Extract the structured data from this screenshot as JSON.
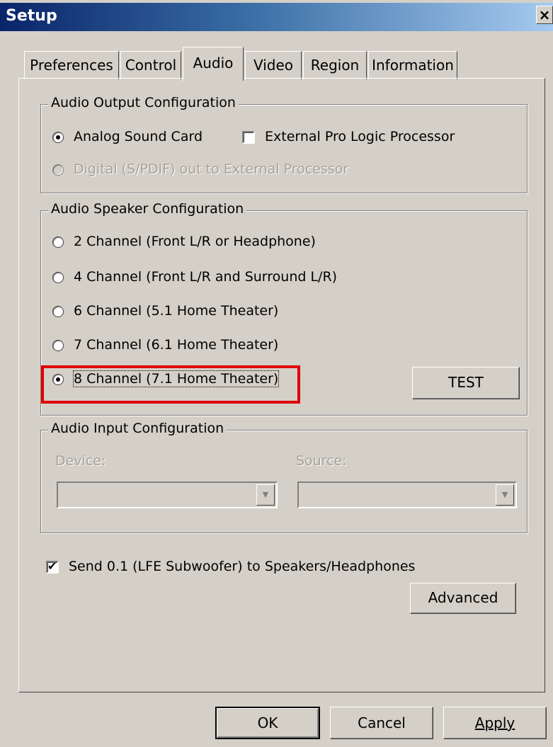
{
  "window": {
    "title": "Setup",
    "close_label": "×"
  },
  "tabs": [
    {
      "label": "Preferences"
    },
    {
      "label": "Control"
    },
    {
      "label": "Audio"
    },
    {
      "label": "Video"
    },
    {
      "label": "Region"
    },
    {
      "label": "Information"
    }
  ],
  "active_tab": "Audio",
  "output_config": {
    "legend": "Audio Output Configuration",
    "analog_label": "Analog Sound Card",
    "pro_logic_label": "External Pro Logic Processor",
    "digital_label": "Digital (S/PDIF) out to External Processor"
  },
  "speaker_config": {
    "legend": "Audio Speaker Configuration",
    "options": [
      {
        "label": "2 Channel (Front L/R or Headphone)"
      },
      {
        "label": "4 Channel (Front L/R and Surround L/R)"
      },
      {
        "label": "6 Channel (5.1 Home Theater)"
      },
      {
        "label": "7 Channel (6.1 Home Theater)"
      },
      {
        "label": "8 Channel (7.1 Home Theater)"
      }
    ],
    "selected": "8 Channel (7.1 Home Theater)",
    "test_label": "TEST"
  },
  "input_config": {
    "legend": "Audio Input Configuration",
    "device_label": "Device:",
    "source_label": "Source:",
    "device_value": "",
    "source_value": ""
  },
  "lfe": {
    "label": "Send 0.1 (LFE Subwoofer) to Speakers/Headphones",
    "checked": true
  },
  "advanced_label": "Advanced",
  "footer": {
    "ok_label": "OK",
    "cancel_label": "Cancel",
    "apply_label": "Apply"
  },
  "colors": {
    "highlight": "#e00000",
    "title_gradient_start": "#0a246a",
    "title_gradient_end": "#a6caf0",
    "face": "#d4d0c8"
  }
}
